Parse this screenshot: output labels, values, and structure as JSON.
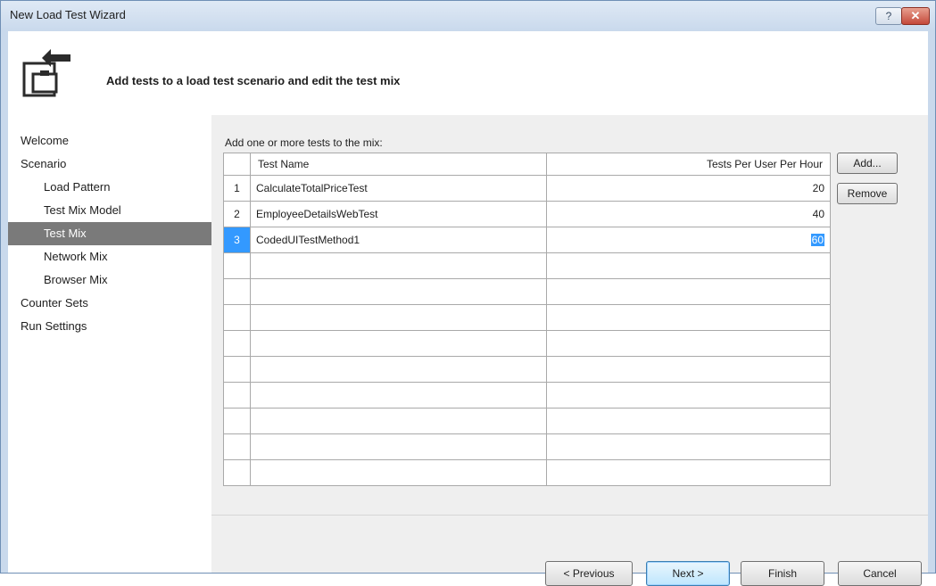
{
  "window": {
    "title": "New Load Test Wizard",
    "help_label": "?",
    "close_label": "✕"
  },
  "header": {
    "text": "Add tests to a load test scenario and edit the test mix"
  },
  "nav": {
    "items": [
      {
        "label": "Welcome",
        "level": 0,
        "selected": false
      },
      {
        "label": "Scenario",
        "level": 0,
        "selected": false
      },
      {
        "label": "Load Pattern",
        "level": 1,
        "selected": false
      },
      {
        "label": "Test Mix Model",
        "level": 1,
        "selected": false
      },
      {
        "label": "Test Mix",
        "level": 1,
        "selected": true
      },
      {
        "label": "Network Mix",
        "level": 1,
        "selected": false
      },
      {
        "label": "Browser Mix",
        "level": 1,
        "selected": false
      },
      {
        "label": "Counter Sets",
        "level": 0,
        "selected": false
      },
      {
        "label": "Run Settings",
        "level": 0,
        "selected": false
      }
    ]
  },
  "mix": {
    "label": "Add one or more tests to the mix:",
    "columns": {
      "name": "Test Name",
      "rate": "Tests Per User Per Hour"
    },
    "rows": [
      {
        "num": "1",
        "name": "CalculateTotalPriceTest",
        "rate": "20"
      },
      {
        "num": "2",
        "name": "EmployeeDetailsWebTest",
        "rate": "40"
      },
      {
        "num": "3",
        "name": "CodedUITestMethod1",
        "rate": "60"
      }
    ],
    "add_label": "Add...",
    "remove_label": "Remove"
  },
  "footer": {
    "previous_label": "< Previous",
    "next_label": "Next >",
    "finish_label": "Finish",
    "cancel_label": "Cancel"
  },
  "colors": {
    "selection": "#3399ff",
    "nav_selected": "#7a7a7a"
  }
}
